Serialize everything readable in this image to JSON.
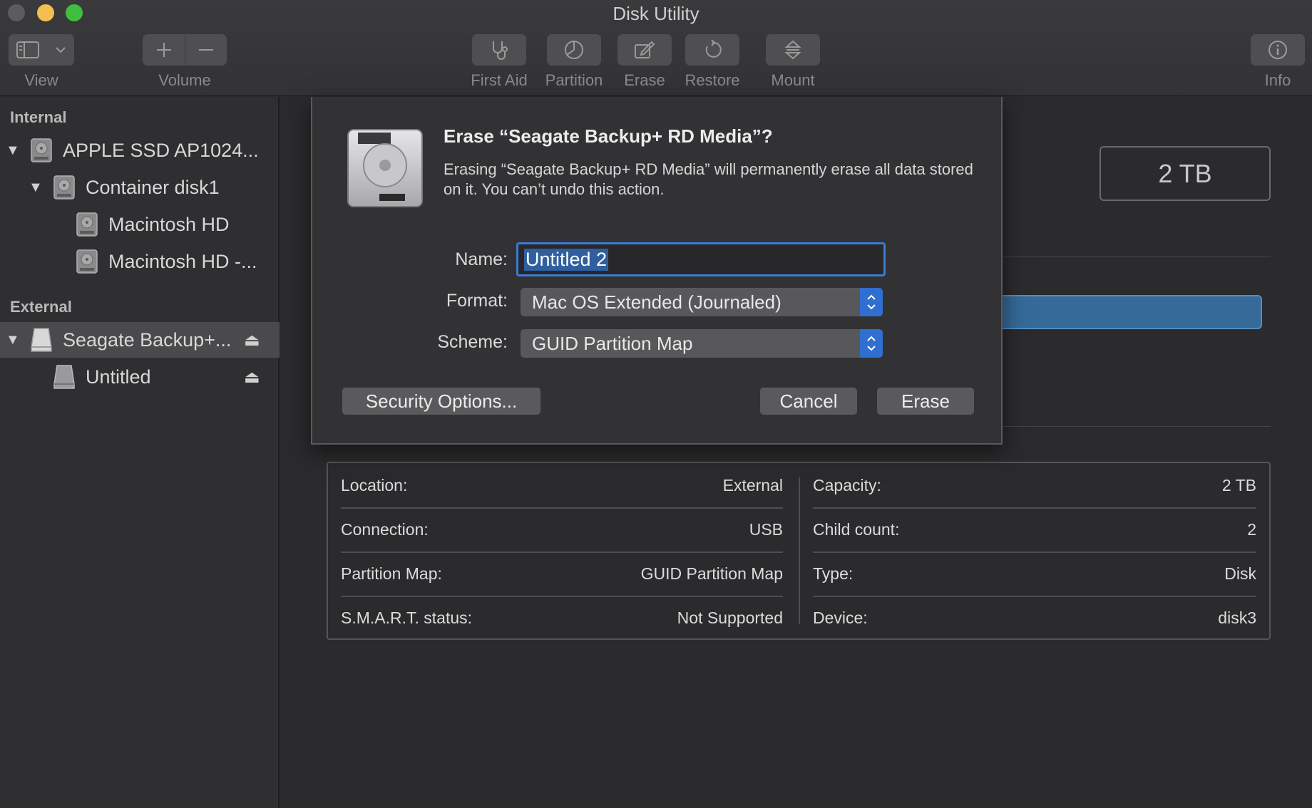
{
  "window": {
    "title": "Disk Utility"
  },
  "toolbar": {
    "view_label": "View",
    "volume_label": "Volume",
    "first_aid_label": "First Aid",
    "partition_label": "Partition",
    "erase_label": "Erase",
    "restore_label": "Restore",
    "mount_label": "Mount",
    "info_label": "Info"
  },
  "sidebar": {
    "internal_header": "Internal",
    "external_header": "External",
    "items": [
      {
        "label": "APPLE SSD AP1024..."
      },
      {
        "label": "Container disk1"
      },
      {
        "label": "Macintosh HD"
      },
      {
        "label": "Macintosh HD -..."
      },
      {
        "label": "Seagate Backup+..."
      },
      {
        "label": "Untitled"
      }
    ]
  },
  "main": {
    "capacity_display": "2 TB",
    "info": {
      "location_key": "Location:",
      "location_val": "External",
      "connection_key": "Connection:",
      "connection_val": "USB",
      "partition_map_key": "Partition Map:",
      "partition_map_val": "GUID Partition Map",
      "smart_key": "S.M.A.R.T. status:",
      "smart_val": "Not Supported",
      "capacity_key": "Capacity:",
      "capacity_val": "2 TB",
      "child_count_key": "Child count:",
      "child_count_val": "2",
      "type_key": "Type:",
      "type_val": "Disk",
      "device_key": "Device:",
      "device_val": "disk3"
    }
  },
  "sheet": {
    "title": "Erase “Seagate Backup+ RD Media”?",
    "message": "Erasing “Seagate Backup+ RD Media” will permanently erase all data stored on it. You can’t undo this action.",
    "name_label": "Name:",
    "name_value": "Untitled 2",
    "format_label": "Format:",
    "format_value": "Mac OS Extended (Journaled)",
    "scheme_label": "Scheme:",
    "scheme_value": "GUID Partition Map",
    "security_button": "Security Options...",
    "cancel_button": "Cancel",
    "erase_button": "Erase"
  },
  "colors": {
    "accent": "#2e6fd0",
    "background": "#2b2b2d",
    "sidebar": "#2f2f31",
    "close_button": "#5c5c5e",
    "minimize_button": "#f4bf4f",
    "zoom_button": "#3fbf3f"
  },
  "icons": [
    "sidebar-view-icon",
    "chevron-down-icon",
    "plus-icon",
    "minus-icon",
    "stethoscope-icon",
    "pie-icon",
    "eraser-icon",
    "restore-icon",
    "mount-icon",
    "info-icon",
    "disclosure-triangle-icon",
    "disk-icon",
    "eject-icon",
    "hard-drive-icon",
    "popup-arrows-icon"
  ]
}
